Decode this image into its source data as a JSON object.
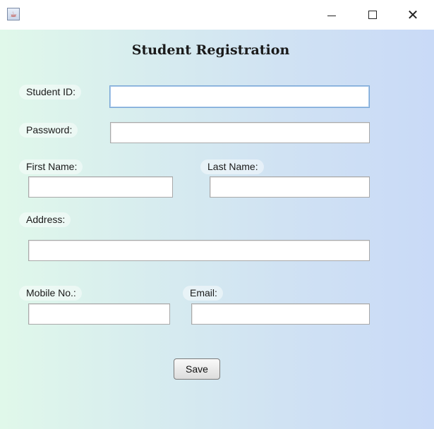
{
  "window": {
    "app_icon": "java-cup-icon",
    "controls": {
      "minimize": "minimize-icon",
      "maximize": "maximize-icon",
      "close": "✕"
    }
  },
  "form": {
    "title": "Student Registration",
    "fields": {
      "student_id": {
        "label": "Student ID:",
        "value": ""
      },
      "password": {
        "label": "Password:",
        "value": ""
      },
      "first_name": {
        "label": "First Name:",
        "value": ""
      },
      "last_name": {
        "label": "Last Name:",
        "value": ""
      },
      "address": {
        "label": "Address:",
        "value": ""
      },
      "mobile": {
        "label": "Mobile No.:",
        "value": ""
      },
      "email": {
        "label": "Email:",
        "value": ""
      }
    },
    "save_label": "Save"
  },
  "colors": {
    "gradient_left": "#e0f8ea",
    "gradient_right": "#c9daf7",
    "focus_border": "#7aa7d6"
  }
}
